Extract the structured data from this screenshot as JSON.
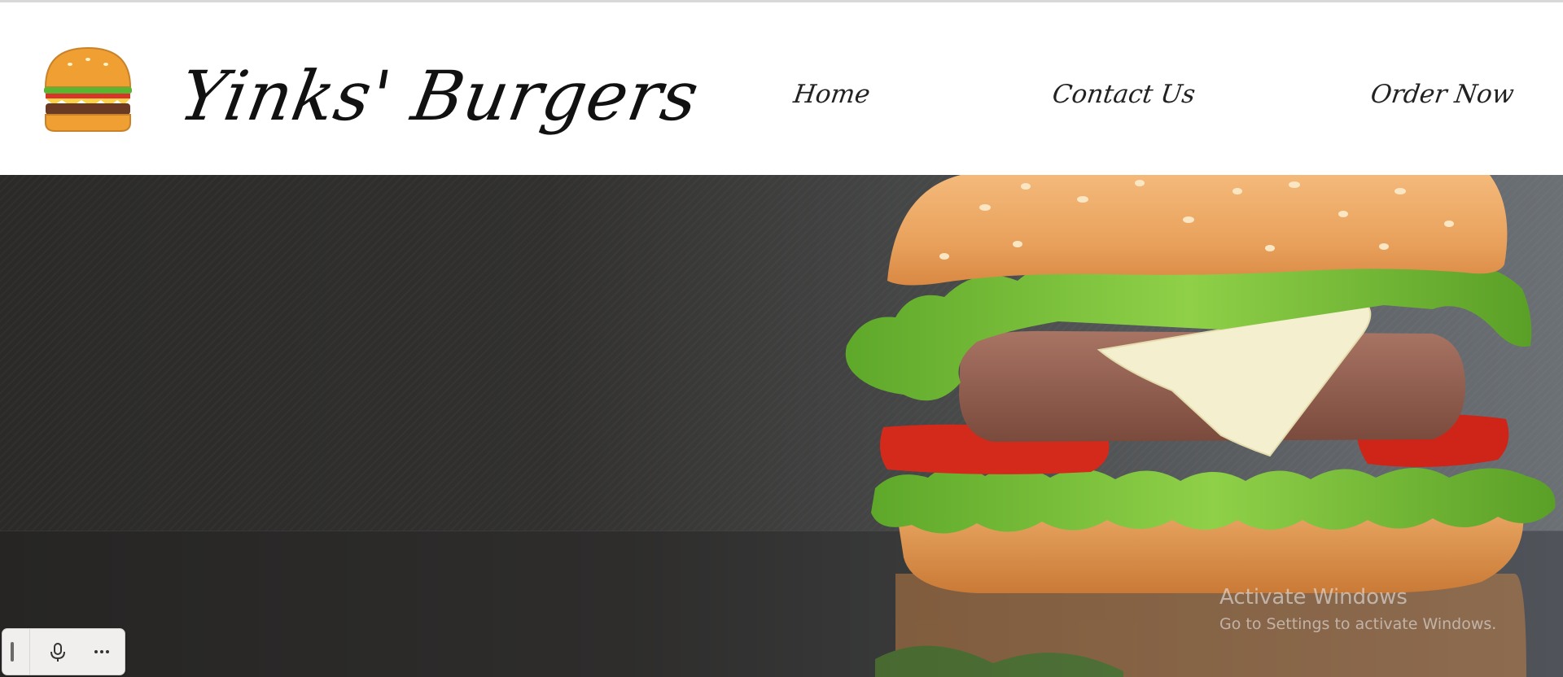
{
  "header": {
    "logo_icon": "burger-logo-icon",
    "brand_name": "Yinks' Burgers",
    "nav": [
      {
        "label": "Home"
      },
      {
        "label": "Contact Us"
      },
      {
        "label": "Order Now"
      }
    ]
  },
  "hero": {
    "image": "burger-hero-photo"
  },
  "watermark": {
    "title": "Activate Windows",
    "subtitle": "Go to Settings to activate Windows."
  },
  "voice_toolbar": {
    "handle_icon": "drag-handle-icon",
    "mic_icon": "microphone-icon",
    "more_icon": "more-options-icon"
  },
  "colors": {
    "header_bg": "#ffffff",
    "nav_text": "#222222",
    "hero_dark": "#2b2a28",
    "hero_light": "#6b7075"
  }
}
